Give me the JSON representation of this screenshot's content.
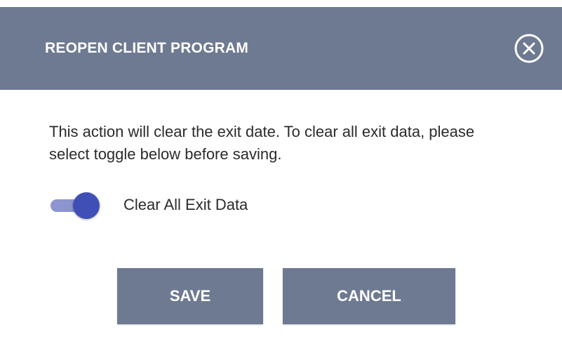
{
  "dialog": {
    "title": "REOPEN CLIENT PROGRAM",
    "close_icon": "close-circle-icon",
    "message": "This action will clear the exit date. To clear all exit data, please select toggle below before saving.",
    "toggle": {
      "label": "Clear All Exit Data",
      "checked": true
    },
    "buttons": {
      "save_label": "SAVE",
      "cancel_label": "CANCEL"
    }
  },
  "colors": {
    "header_bg": "#6e7a91",
    "button_bg": "#6e7a91",
    "toggle_track": "#8c95cf",
    "toggle_knob": "#3f4fb5",
    "text": "#2b2b2b"
  }
}
